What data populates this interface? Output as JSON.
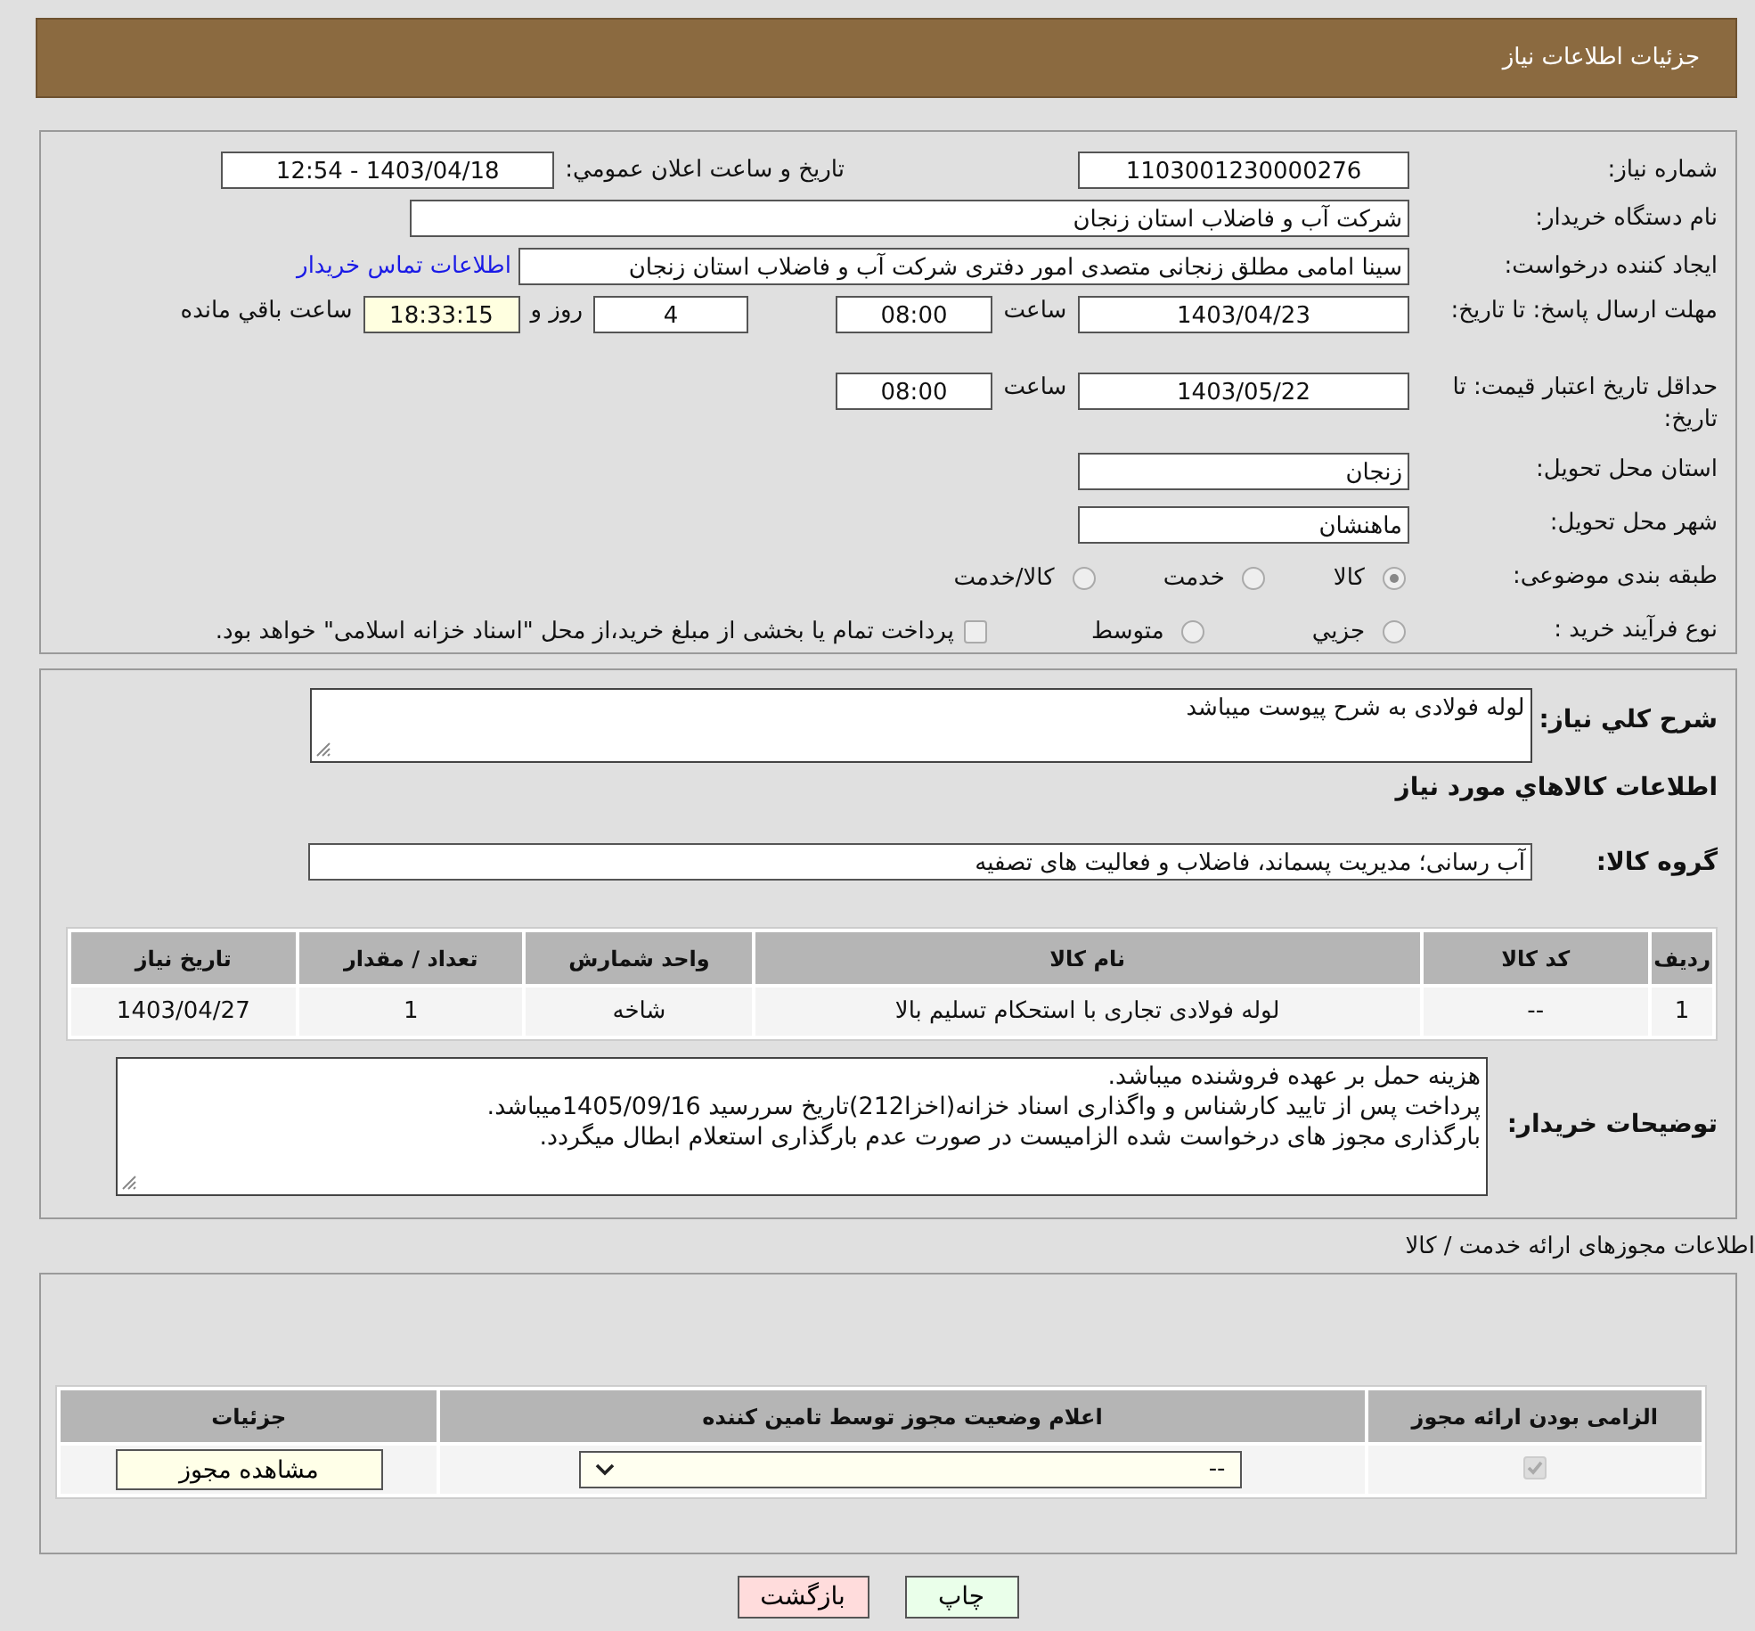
{
  "header": {
    "title": "جزئیات اطلاعات نیاز"
  },
  "details": {
    "need_number": {
      "label": "شماره نیاز:",
      "value": "1103001230000276"
    },
    "announce": {
      "label": "تاریخ و ساعت اعلان عمومي:",
      "value": "1403/04/18 - 12:54"
    },
    "buyer_org": {
      "label": "نام دستگاه خریدار:",
      "value": "شرکت آب و فاضلاب استان زنجان"
    },
    "requester": {
      "label": "ایجاد کننده درخواست:",
      "value": "سینا امامی مطلق زنجانی متصدی امور دفتری شرکت آب و فاضلاب استان زنجان",
      "link": "اطلاعات تماس خریدار"
    },
    "response_deadline": {
      "label": "مهلت ارسال پاسخ: تا تاریخ:",
      "date": "1403/04/23",
      "time_label": "ساعت",
      "time": "08:00",
      "days": "4",
      "days_label": "روز و",
      "remaining": "18:33:15",
      "remaining_label": "ساعت باقي مانده"
    },
    "price_validity": {
      "label": "حداقل تاریخ اعتبار قیمت: تا تاریخ:",
      "date": "1403/05/22",
      "time_label": "ساعت",
      "time": "08:00"
    },
    "province": {
      "label": "استان محل تحویل:",
      "value": "زنجان"
    },
    "city": {
      "label": "شهر محل تحویل:",
      "value": "ماهنشان"
    },
    "category": {
      "label": "طبقه بندی موضوعی:",
      "options": [
        {
          "label": "کالا",
          "selected": true
        },
        {
          "label": "خدمت",
          "selected": false
        },
        {
          "label": "کالا/خدمت",
          "selected": false
        }
      ]
    },
    "purchase_type": {
      "label": "نوع فرآیند خرید :",
      "options": [
        {
          "label": "جزيي",
          "selected": false
        },
        {
          "label": "متوسط",
          "selected": false
        }
      ],
      "treasury": {
        "checked": false,
        "text": "پرداخت تمام یا بخشی از مبلغ خرید،از محل \"اسناد خزانه اسلامی\" خواهد بود."
      }
    }
  },
  "description": {
    "label": "شرح کلي نياز:",
    "value": "لوله فولادی به شرح پیوست میباشد"
  },
  "goods": {
    "title": "اطلاعات کالاهاي مورد نياز",
    "group_label": "گروه کالا:",
    "group": "آب رسانی؛ مدیریت پسماند، فاضلاب و فعالیت های تصفیه",
    "columns": [
      "ردیف",
      "کد کالا",
      "نام کالا",
      "واحد شمارش",
      "تعداد / مقدار",
      "تاریخ نیاز"
    ],
    "rows": [
      [
        "1",
        "--",
        "لوله فولادی تجاری با استحکام تسلیم بالا",
        "شاخه",
        "1",
        "1403/04/27"
      ]
    ]
  },
  "buyer_notes": {
    "label": "توضیحات خریدار:",
    "lines": [
      "هزینه حمل بر عهده فروشنده میباشد.",
      "پرداخت پس از تایید کارشناس و واگذاری اسناد خزانه(اخزا212)تاریخ سررسید 1405/09/16میباشد.",
      "بارگذاری مجوز های درخواست شده الزامیست در صورت عدم بارگذاری استعلام ابطال میگردد."
    ]
  },
  "permits": {
    "title": "اطلاعات مجوزهای ارائه خدمت / کالا",
    "columns": [
      "الزامی بودن ارائه مجوز",
      "اعلام وضعیت مجوز توسط تامین کننده",
      "جزئیات"
    ],
    "rows": [
      {
        "required": true,
        "status": "--",
        "button": "مشاهده مجوز"
      }
    ]
  },
  "buttons": [
    {
      "label": "چاپ",
      "kind": "print"
    },
    {
      "label": "بازگشت",
      "kind": "back"
    }
  ]
}
